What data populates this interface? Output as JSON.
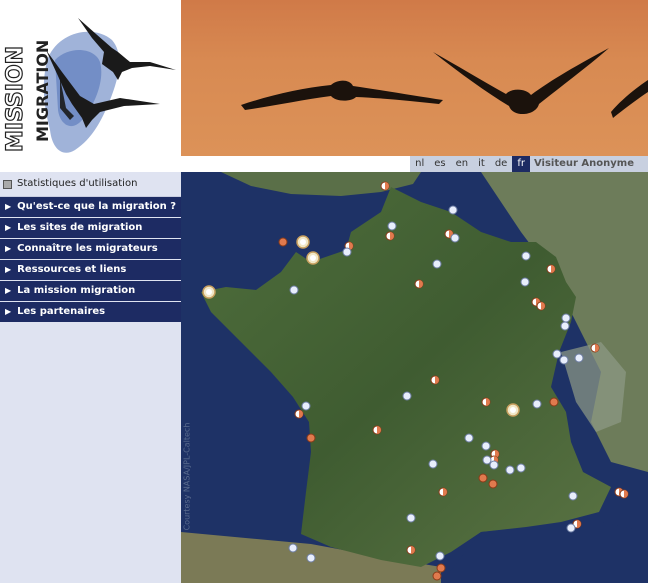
{
  "logo": {
    "word1": "MIGRATION",
    "word2": "MISSION"
  },
  "languages": [
    {
      "code": "nl",
      "active": false
    },
    {
      "code": "es",
      "active": false
    },
    {
      "code": "en",
      "active": false
    },
    {
      "code": "it",
      "active": false
    },
    {
      "code": "de",
      "active": false
    },
    {
      "code": "fr",
      "active": true
    }
  ],
  "visitor_label": "Visiteur Anonyme",
  "stats_label": "Statistiques d'utilisation",
  "nav_items": [
    "Qu'est-ce que la migration ?",
    "Les sites de migration",
    "Connaître les migrateurs",
    "Ressources et liens",
    "La mission migration",
    "Les partenaires"
  ],
  "map_credit": "Courtesy NASA/JPL-Caltech",
  "colors": {
    "nav": "#1d2b63",
    "sidebar": "#dfe3f1",
    "banner": "#d88a52",
    "sea": "#1e3266"
  }
}
